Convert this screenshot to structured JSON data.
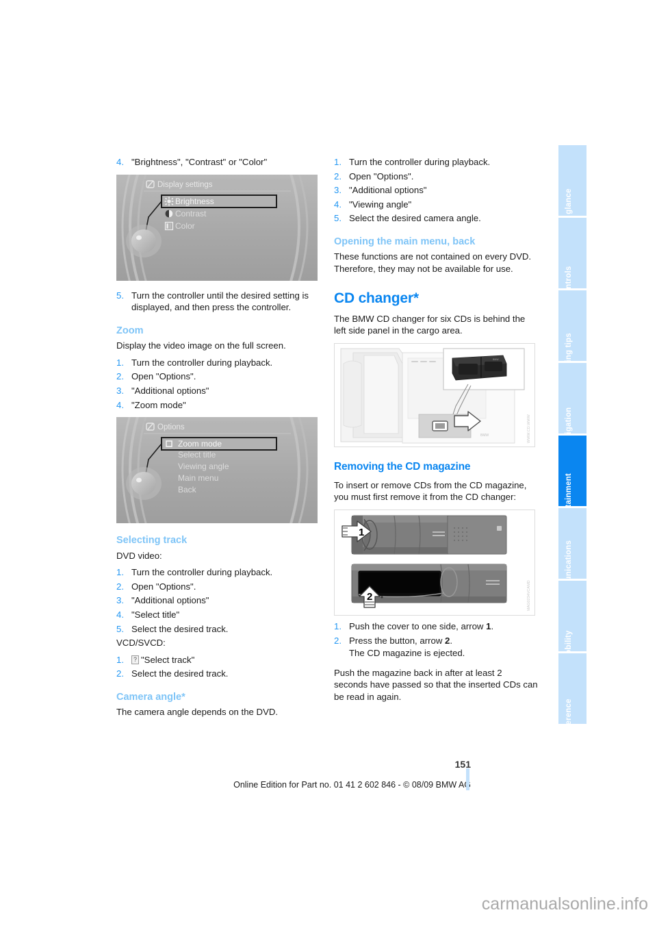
{
  "document": {
    "page_number": "151",
    "edition_line": "Online Edition for Part no. 01 41 2 602 846 - © 08/09 BMW AG",
    "watermark": "carmanualsonline.info",
    "accent_heading": "#0a86f0",
    "accent_subheading": "#7ec4f7",
    "accent_number": "#2196f3",
    "sidebar_tab_bg": "#c3e1fb",
    "sidebar_tab_active_bg": "#0a86f0"
  },
  "sidebar": {
    "tabs": [
      {
        "label": "At a glance",
        "active": false
      },
      {
        "label": "Controls",
        "active": false
      },
      {
        "label": "Driving tips",
        "active": false
      },
      {
        "label": "Navigation",
        "active": false
      },
      {
        "label": "Entertainment",
        "active": true
      },
      {
        "label": "Communications",
        "active": false
      },
      {
        "label": "Mobility",
        "active": false
      },
      {
        "label": "Reference",
        "active": false
      }
    ]
  },
  "left_column": {
    "step4_continued": {
      "num": "4.",
      "text": "\"Brightness\", \"Contrast\" or \"Color\""
    },
    "figure_display_settings": {
      "caption": "",
      "menu_title": "Display settings",
      "items": [
        "Brightness",
        "Contrast",
        "Color"
      ],
      "selected": "Brightness"
    },
    "step5": {
      "num": "5.",
      "text": "Turn the controller until the desired setting is displayed, and then press the controller."
    },
    "zoom_section": {
      "heading": "Zoom",
      "intro": "Display the video image on the full screen.",
      "steps": [
        {
          "num": "1.",
          "text": "Turn the controller during playback."
        },
        {
          "num": "2.",
          "text": "Open \"Options\"."
        },
        {
          "num": "3.",
          "text": "\"Additional options\""
        },
        {
          "num": "4.",
          "text": "\"Zoom mode\""
        }
      ]
    },
    "figure_options": {
      "menu_title": "Options",
      "items": [
        "Zoom mode",
        "Select title",
        "Viewing angle",
        "Main menu",
        "Back"
      ],
      "selected": "Zoom mode"
    },
    "selecting_track_section": {
      "heading": "Selecting track",
      "intro_dvd": "DVD video:",
      "dvd_steps": [
        {
          "num": "1.",
          "text": "Turn the controller during playback."
        },
        {
          "num": "2.",
          "text": "Open \"Options\"."
        },
        {
          "num": "3.",
          "text": "\"Additional options\""
        },
        {
          "num": "4.",
          "text": "\"Select title\""
        },
        {
          "num": "5.",
          "text": "Select the desired track."
        }
      ],
      "intro_vcd": "VCD/SVCD:",
      "vcd_steps": [
        {
          "num": "1.",
          "glyph": "?",
          "text": "\"Select track\""
        },
        {
          "num": "2.",
          "text": "Select the desired track."
        }
      ]
    },
    "camera_angle_section": {
      "heading": "Camera angle*",
      "text": "The camera angle depends on the DVD."
    }
  },
  "right_column": {
    "camera_angle_steps": [
      {
        "num": "1.",
        "text": "Turn the controller during playback."
      },
      {
        "num": "2.",
        "text": "Open \"Options\"."
      },
      {
        "num": "3.",
        "text": "\"Additional options\""
      },
      {
        "num": "4.",
        "text": "\"Viewing angle\""
      },
      {
        "num": "5.",
        "text": "Select the desired camera angle."
      }
    ],
    "main_menu_section": {
      "heading": "Opening the main menu, back",
      "text": "These functions are not contained on every DVD. Therefore, they may not be available for use."
    },
    "cd_changer_section": {
      "heading": "CD changer*",
      "text": "The BMW CD changer for six CDs is behind the left side panel in the cargo area."
    },
    "figure_cargo_area": {
      "watermark": "WWW.CD.WWW"
    },
    "removing_magazine_section": {
      "heading": "Removing the CD magazine",
      "text": "To insert or remove CDs from the CD magazine, you must first remove it from the CD changer:"
    },
    "figure_magazine": {
      "arrow_labels": [
        "1",
        "2"
      ],
      "watermark": "MAG0234VCAMD"
    },
    "removing_steps": [
      {
        "num": "1.",
        "text": "Push the cover to one side, arrow ",
        "bold": "1",
        "tail": "."
      },
      {
        "num": "2.",
        "text": "Press the button, arrow ",
        "bold": "2",
        "tail": ".",
        "sub": "The CD magazine is ejected."
      }
    ],
    "closing_note": "Push the magazine back in after at least 2 seconds have passed so that the inserted CDs can be read in again."
  }
}
